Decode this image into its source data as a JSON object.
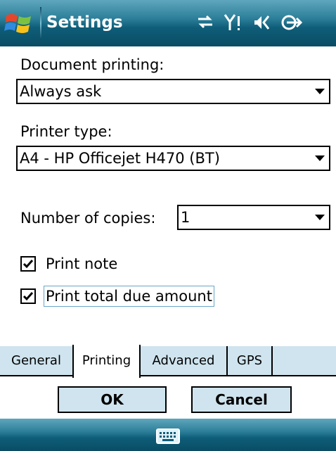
{
  "titlebar": {
    "title": "Settings",
    "status_icons": [
      "connectivity-icon",
      "signal-icon",
      "volume-icon",
      "battery-icon"
    ]
  },
  "form": {
    "document_printing_label": "Document printing:",
    "document_printing_value": "Always ask",
    "printer_type_label": "Printer type:",
    "printer_type_value": "A4 - HP Officejet H470 (BT)",
    "copies_label": "Number of copies:",
    "copies_value": "1",
    "print_note_label": "Print note",
    "print_note_checked": true,
    "print_total_label": "Print total due amount",
    "print_total_checked": true
  },
  "tabs": [
    {
      "label": "General",
      "active": false
    },
    {
      "label": "Printing",
      "active": true
    },
    {
      "label": "Advanced",
      "active": false
    },
    {
      "label": "GPS",
      "active": false
    }
  ],
  "buttons": {
    "ok": "OK",
    "cancel": "Cancel"
  },
  "bottombar": {
    "icon": "keyboard-icon"
  },
  "colors": {
    "accent": "#0e5d78",
    "tab_bg": "#cfe4ee"
  }
}
